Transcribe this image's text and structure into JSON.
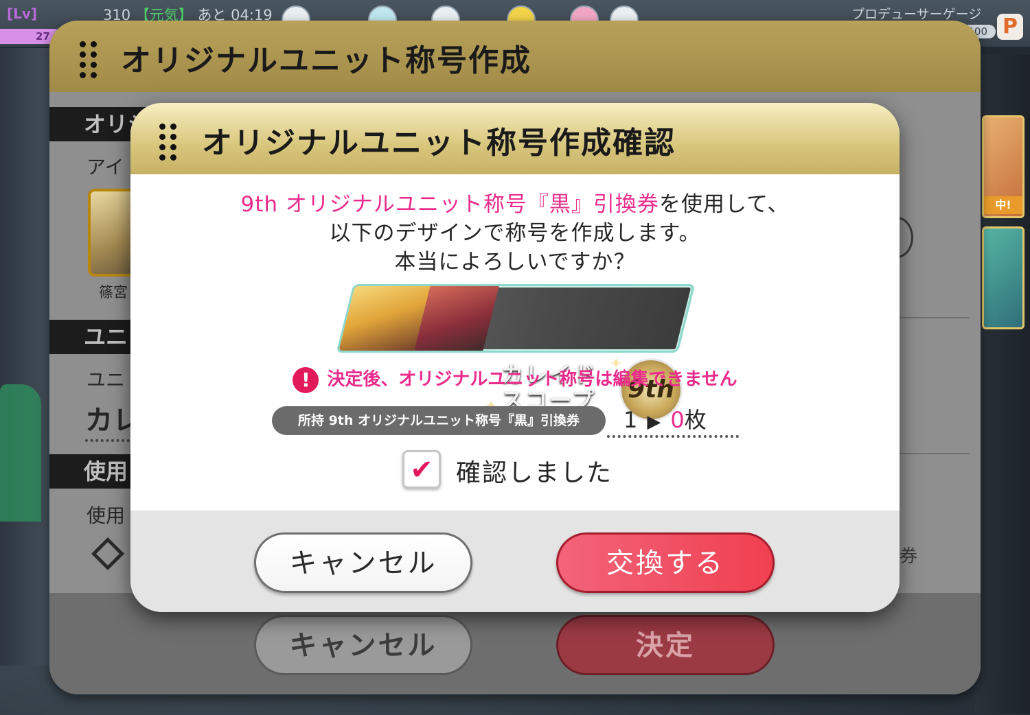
{
  "hud": {
    "lv_label": "[Lv]",
    "lv_value": "27",
    "stamina_value": "310",
    "stamina_tag": "【元気】",
    "stamina_time": "あと 04:19",
    "gauge_label": "プロデューサーゲージ",
    "gauge_value": "100",
    "p_badge": "P",
    "side_badge": "中!"
  },
  "back_dialog": {
    "title": "オリジナルユニット称号作成",
    "section_original": "オリジ",
    "label_idol": "アイ",
    "portrait_name": "篠宮",
    "section_unit": "ユニ",
    "label_unit": "ユニ",
    "unit_name": "カレ",
    "section_use": "使用",
    "label_use": "使用",
    "right_text": "券",
    "cancel_label": "キャンセル",
    "decide_label": "決定"
  },
  "modal": {
    "title": "オリジナルユニット称号作成確認",
    "msg_line1_highlight": "9th オリジナルユニット称号『黒』引換券",
    "msg_line1_rest": "を使用して、",
    "msg_line2": "以下のデザインで称号を作成します。",
    "msg_line3": "本当によろしいですか？",
    "banner_text_line1": "カレイド",
    "banner_text_line2": "スコープ",
    "banner_badge": "9th",
    "warning": "決定後、オリジナルユニット称号は編集できません",
    "ticket_label": "所持 9th オリジナルユニット称号『黒』引換券",
    "ticket_before": "1",
    "ticket_after": "0",
    "ticket_unit": "枚",
    "confirm_label": "確認しました",
    "confirm_checked": true,
    "cancel_label": "キャンセル",
    "exchange_label": "交換する"
  },
  "colors": {
    "accent_pink": "#ea2b8c",
    "header_gold": "#d8c67c",
    "exchange_red": "#f04050"
  }
}
